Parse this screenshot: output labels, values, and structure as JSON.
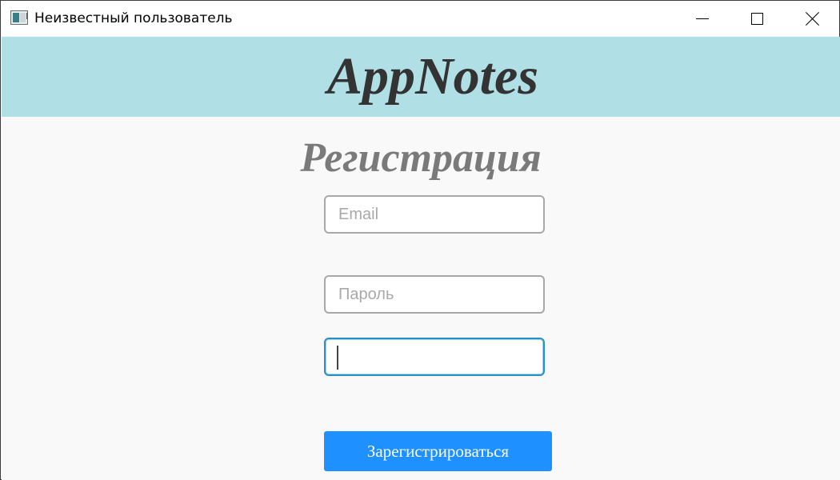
{
  "window": {
    "title": "Неизвестный пользователь",
    "icon": "app-window-icon",
    "controls": {
      "minimize": "minimize-icon",
      "maximize": "maximize-icon",
      "close": "close-icon"
    }
  },
  "header": {
    "brand": "AppNotes",
    "background_color": "#b0dfe5"
  },
  "form": {
    "title": "Регистрация",
    "email": {
      "value": "",
      "placeholder": "Email"
    },
    "password": {
      "value": "",
      "placeholder": "Пароль"
    },
    "password_confirm": {
      "value": "",
      "placeholder": "",
      "focused": true
    },
    "submit_label": "Зарегистрироваться",
    "submit_color": "#1e90ff"
  }
}
